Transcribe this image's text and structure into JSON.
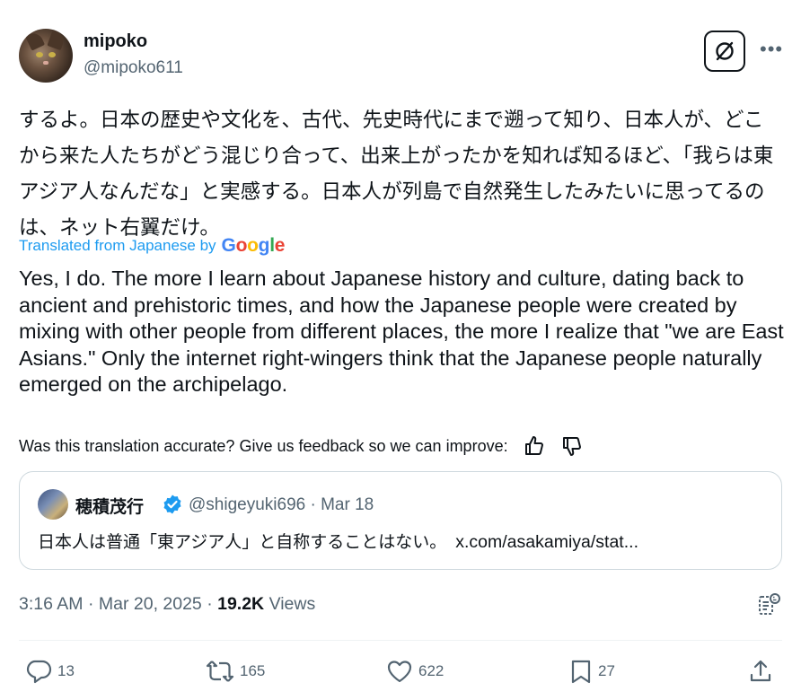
{
  "author": {
    "name": "mipoko",
    "handle": "@mipoko611"
  },
  "tweet": {
    "text_jp": "するよ。日本の歴史や文化を、古代、先史時代にまで遡って知り、日本人が、どこから来た人たちがどう混じり合って、出来上がったかを知れば知るほど、「我らは東アジア人なんだな」と実感する。日本人が列島で自然発生したみたいに思ってるのは、ネット右翼だけ。",
    "translated_label": "Translated from Japanese by",
    "google_letters": [
      "G",
      "o",
      "o",
      "g",
      "l",
      "e"
    ],
    "text_en": "Yes, I do. The more I learn about Japanese history and culture, dating back to ancient and prehistoric times, and how the Japanese people were created by mixing with other people from different places, the more I realize that \"we are East Asians.\" Only the internet right-wingers think that the Japanese people naturally emerged on the archipelago.",
    "feedback": "Was this translation accurate? Give us feedback so we can improve:"
  },
  "quote": {
    "name": "穂積茂行",
    "meta": "@shigeyuki696 · Mar 18",
    "text": "日本人は普通「東アジア人」と自称することはない。",
    "link": "x.com/asakamiya/stat..."
  },
  "meta": {
    "time_date": "3:16 AM · Mar 20, 2025 · ",
    "views_count": "19.2K",
    "views_label": " Views"
  },
  "actions": {
    "replies": "13",
    "reposts": "165",
    "likes": "622",
    "bookmarks": "27"
  },
  "colors": {
    "accent": "#1d9bf0",
    "secondary_text": "#536471",
    "primary_text": "#0f1419",
    "border": "#cfd9de"
  },
  "icons": [
    "grok-icon",
    "more-icon",
    "thumbs-up-icon",
    "thumbs-down-icon",
    "verified-badge-icon",
    "analytics-icon",
    "reply-icon",
    "repost-icon",
    "like-icon",
    "bookmark-icon",
    "share-icon"
  ]
}
